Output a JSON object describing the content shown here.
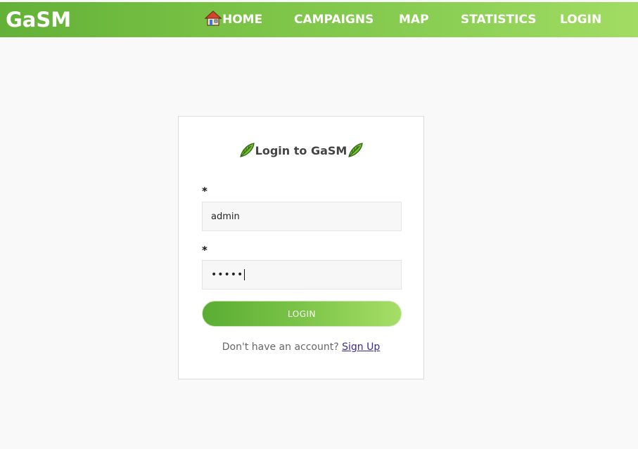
{
  "navbar": {
    "brand": "GaSM",
    "items": [
      {
        "label": "HOME",
        "icon": "house-icon"
      },
      {
        "label": "CAMPAIGNS"
      },
      {
        "label": "MAP"
      },
      {
        "label": "STATISTICS"
      },
      {
        "label": "LOGIN"
      }
    ]
  },
  "login_card": {
    "title": "Login to GaSM",
    "title_icon": "leaf-icon",
    "fields": [
      {
        "required_marker": "*",
        "value": "admin"
      },
      {
        "required_marker": "*",
        "value": "•••••"
      }
    ],
    "submit_label": "LOGIN",
    "signup_prompt": "Don't have an account?",
    "signup_link": "Sign Up"
  },
  "colors": {
    "nav_gradient_start": "#63b138",
    "nav_gradient_end": "#a2dc63",
    "page_background": "#f9f9f9",
    "link_color": "#3a2b8a"
  }
}
